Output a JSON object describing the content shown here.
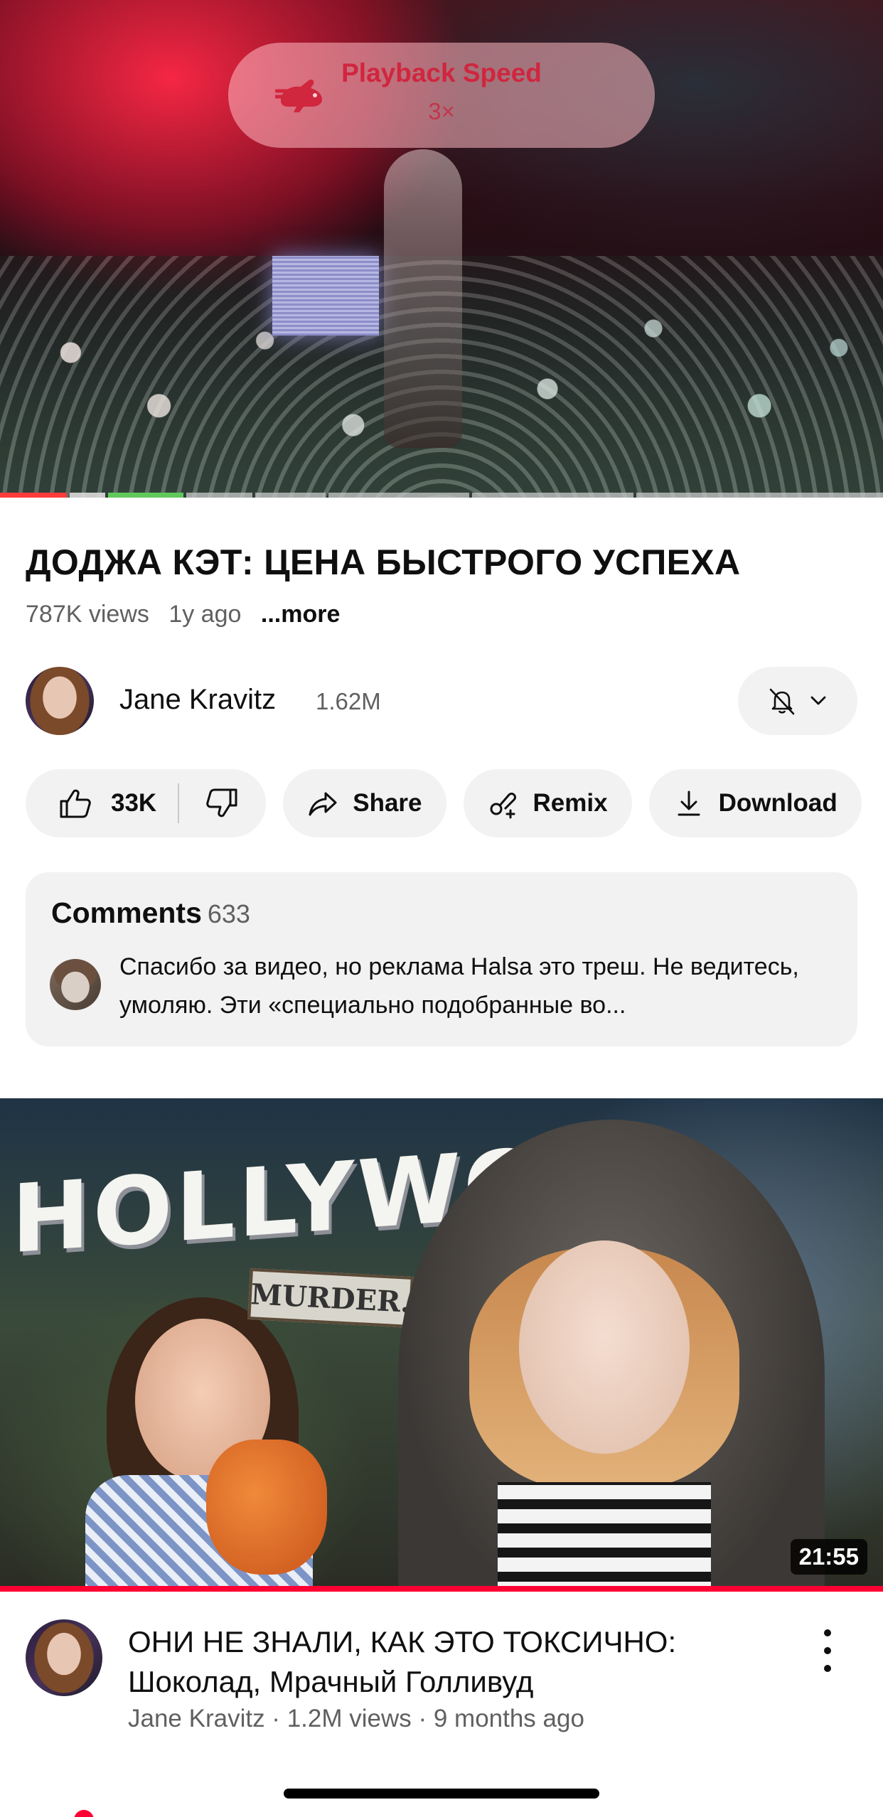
{
  "player": {
    "overlay": {
      "label": "Playback Speed",
      "value": "3×"
    },
    "accent_color": "#d0263e"
  },
  "video": {
    "title": "ДОДЖА КЭТ: ЦЕНА БЫСТРОГО УСПЕХА",
    "views": "787K views",
    "age": "1y ago",
    "more": "...more"
  },
  "channel": {
    "name": "Jane Kravitz",
    "subscribers": "1.62M"
  },
  "actions": {
    "likes": "33K",
    "share": "Share",
    "remix": "Remix",
    "download": "Download"
  },
  "comments": {
    "label": "Comments",
    "count": "633",
    "top_comment": "Спасибо за видео, но реклама Halsa это треш. Не ведитесь, умоляю. Эти «специально подобранные во..."
  },
  "next_video": {
    "thumbnail_text": "HOLLYWOOD",
    "sign_text": "MURDER.",
    "duration": "21:55",
    "title": "ОНИ НЕ ЗНАЛИ, КАК ЭТО ТОКСИЧНО: Шоколад, Мрачный Голливуд",
    "meta": "Jane Kravitz · 1.2M views · 9 months ago",
    "progress_color": "#ff0033"
  }
}
